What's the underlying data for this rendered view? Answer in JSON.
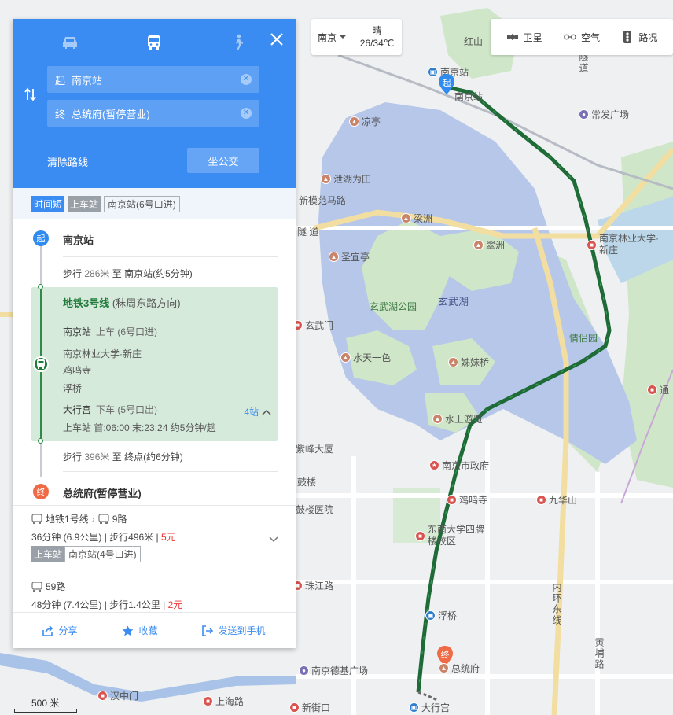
{
  "header": {
    "modes": [
      {
        "name": "drive",
        "active": false
      },
      {
        "name": "bus",
        "active": true
      },
      {
        "name": "walk",
        "active": false
      }
    ],
    "start_tag": "起",
    "start_value": "南京站",
    "end_tag": "终",
    "end_value": "总统府(暂停营业)",
    "clear_route": "清除路线",
    "bus_button": "坐公交"
  },
  "weather": {
    "city": "南京",
    "condition": "晴",
    "temperature": "26/34℃"
  },
  "layers": {
    "satellite": "卫星",
    "air": "空气",
    "traffic": "路况"
  },
  "plan": {
    "tag_fast": "时间短",
    "tag_board": "上车站",
    "board_station": "南京站(6号口进)",
    "start_marker": "起",
    "start_name": "南京站",
    "walk1_prefix": "步行",
    "walk1_distance": "286米",
    "walk1_suffix": "至 南京站(约5分钟)",
    "metro": {
      "line": "地铁3号线",
      "direction": "(秣周东路方向)",
      "board_stop": "南京站",
      "board_action": "上车 (6号口进)",
      "stops": [
        "南京林业大学·新庄",
        "鸡鸣寺",
        "浮桥"
      ],
      "alight_stop": "大行宫",
      "alight_action": "下车 (5号口出)",
      "times": "上车站 首:06:00  末:23:24  约5分钟/趟",
      "count": "4站"
    },
    "walk2_prefix": "步行",
    "walk2_distance": "396米",
    "walk2_suffix": "至 终点(约6分钟)",
    "end_marker": "终",
    "end_name": "总统府(暂停营业)"
  },
  "alternatives": [
    {
      "route_a": "地铁1号线",
      "route_b": "9路",
      "summary": "36分钟 (6.9公里) | 步行496米 |",
      "price": "5元",
      "board_label": "上车站",
      "board_station": "南京站(4号口进)"
    },
    {
      "route_a": "59路",
      "summary": "48分钟 (7.4公里) | 步行1.4公里 |",
      "price": "2元"
    }
  ],
  "footer": {
    "share": "分享",
    "favorite": "收藏",
    "send": "发送到手机"
  },
  "map": {
    "scale": "500 米",
    "lake_label": "玄武湖",
    "park_label": "玄武湖公园",
    "lovers_park": "情侣园",
    "start_marker": "起",
    "end_marker": "终",
    "pois": {
      "nanjing_station_top": "南京站",
      "nanjing_station": "南京站",
      "changfa": "常发广场",
      "liangting": "凉亭",
      "xiehu": "泄湖为田",
      "xinmofan": "新模范马路",
      "liangzhou": "梁洲",
      "cuizhou": "翠洲",
      "shengyi": "圣宜亭",
      "xuanwumen": "玄武门",
      "shuitian": "水天一色",
      "zimei": "姊妹桥",
      "shuishang": "水上游览",
      "forestry": "南京林业大学·新庄",
      "zifeng": "紫峰大厦",
      "gulou": "鼓楼",
      "gov": "南京市政府",
      "jiming": "鸡鸣寺",
      "jiuhuashan": "九华山",
      "gulou_hosp": "鼓楼医院",
      "seu": "东南大学四牌楼校区",
      "zhujiang": "珠江路",
      "fuqiao": "浮桥",
      "presidential": "总统府",
      "deji": "南京德基广场",
      "hanzhongmen": "汉中门",
      "shanghai_rd": "上海路",
      "xinjiekou": "新街口",
      "daxinggong": "大行宫",
      "inner_ring": "内环东线",
      "tunnel": "隧道",
      "tunnel_v": "隧道",
      "huangpu": "黄埔路",
      "xuanwu_tunnel": "隧 道",
      "red_hill": "红山",
      "shengzhou": "通"
    }
  }
}
